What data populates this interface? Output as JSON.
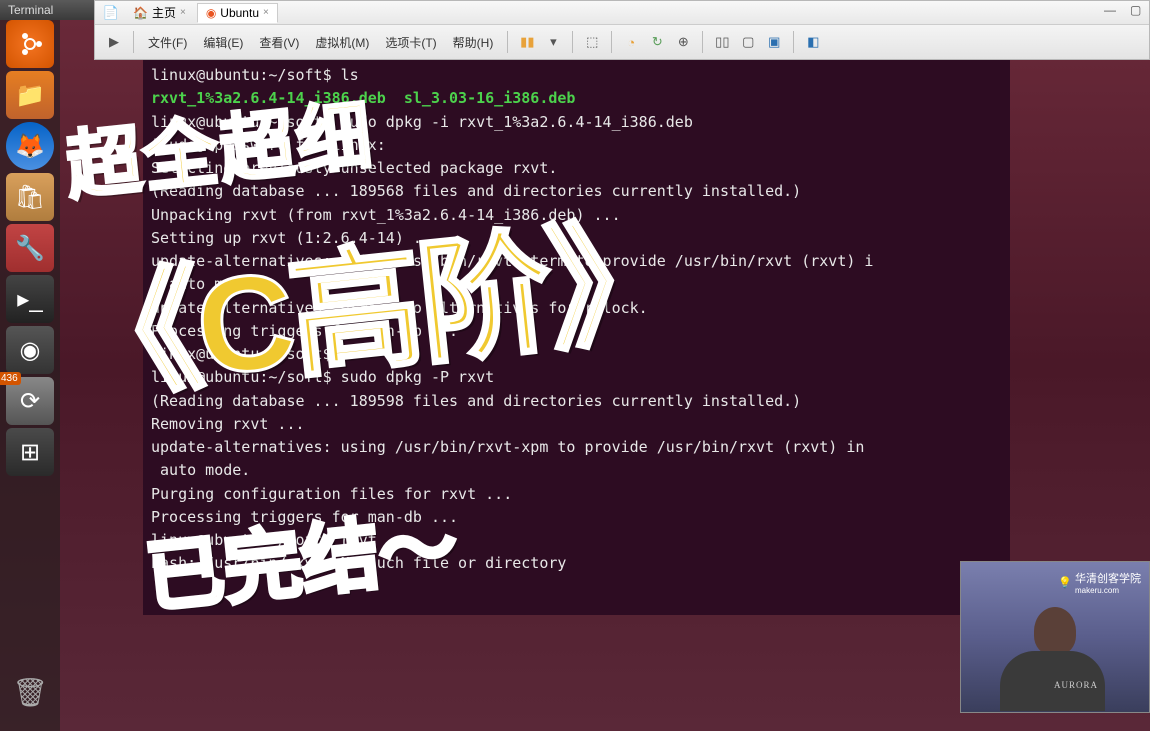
{
  "terminal_title": "Terminal",
  "vmware": {
    "tabs": [
      {
        "icon": "🏠",
        "label": "主页"
      },
      {
        "icon": "◉",
        "label": "Ubuntu"
      }
    ],
    "menu": [
      "文件(F)",
      "编辑(E)",
      "查看(V)",
      "虚拟机(M)",
      "选项卡(T)",
      "帮助(H)"
    ]
  },
  "terminal_lines": [
    {
      "type": "prompt",
      "text": "linux@ubuntu:~/soft$ ls"
    },
    {
      "type": "green",
      "text": "rxvt_1%3a2.6.4-14_i386.deb  sl_3.03-16_i386.deb"
    },
    {
      "type": "plain",
      "text": "linux@ubuntu:~/soft$ sudo dpkg -i rxvt_1%3a2.6.4-14_i386.deb"
    },
    {
      "type": "plain",
      "text": "[sudo] password for linux:"
    },
    {
      "type": "plain",
      "text": "Selecting previously unselected package rxvt."
    },
    {
      "type": "plain",
      "text": "(Reading database ... 189568 files and directories currently installed.)"
    },
    {
      "type": "plain",
      "text": "Unpacking rxvt (from rxvt_1%3a2.6.4-14_i386.deb) ..."
    },
    {
      "type": "plain",
      "text": "Setting up rxvt (1:2.6.4-14) ..."
    },
    {
      "type": "plain",
      "text": "update-alternatives: using /usr/bin/rxvt-xterm to provide /usr/bin/rxvt (rxvt) i"
    },
    {
      "type": "plain",
      "text": "n auto mode."
    },
    {
      "type": "plain",
      "text": "update-alternatives: error: no alternatives for rclock."
    },
    {
      "type": "plain",
      "text": "Processing triggers for man-db ..."
    },
    {
      "type": "plain",
      "text": "linux@ubuntu:~/soft$"
    },
    {
      "type": "plain",
      "text": "linux@ubuntu:~/soft$ sudo dpkg -P rxvt"
    },
    {
      "type": "plain",
      "text": "(Reading database ... 189598 files and directories currently installed.)"
    },
    {
      "type": "plain",
      "text": "Removing rxvt ..."
    },
    {
      "type": "plain",
      "text": "update-alternatives: using /usr/bin/rxvt-xpm to provide /usr/bin/rxvt (rxvt) in"
    },
    {
      "type": "plain",
      "text": " auto mode."
    },
    {
      "type": "plain",
      "text": "Purging configuration files for rxvt ..."
    },
    {
      "type": "plain",
      "text": "Processing triggers for man-db ..."
    },
    {
      "type": "plain",
      "text": "linux@ubuntu:~/soft$ rxvt"
    },
    {
      "type": "plain",
      "text": "bash: /usr/bin/rxvt: No such file or directory"
    }
  ],
  "overlays": {
    "line1": "超全超细",
    "line2": "《C高阶》",
    "line3": "已完结～"
  },
  "webcam": {
    "brand": "华清创客学院",
    "brand_sub": "makeru.com",
    "shirt_text": "AURORA"
  },
  "launcher_badge": "436"
}
